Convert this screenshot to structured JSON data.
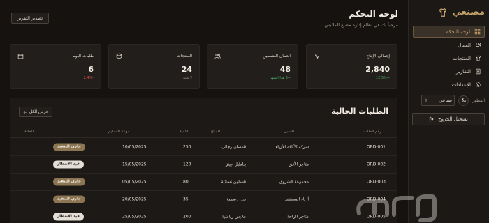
{
  "sidebar": {
    "brand": "مصنعي",
    "items": [
      {
        "label": "لوحة التحكم",
        "icon": "dashboard-icon",
        "active": true
      },
      {
        "label": "العمال",
        "icon": "users-icon"
      },
      {
        "label": "المنتجات",
        "icon": "shirt-icon"
      },
      {
        "label": "التقارير",
        "icon": "reports-icon"
      },
      {
        "label": "الإعدادات",
        "icon": "settings-icon"
      }
    ],
    "appearance_label": "المظهر",
    "theme_value": "صناعي",
    "logout": "تسجيل الخروج"
  },
  "header": {
    "title": "لوحة التحكم",
    "subtitle": "مرحباً بك في نظام إدارة مصنع الملابس",
    "export_label": "تصدير التقرير"
  },
  "stats": [
    {
      "label": "إجمالي الإنتاج",
      "value": "2,840",
      "note": "+12.5%",
      "note_tone": "green",
      "icon": "activity-icon"
    },
    {
      "label": "العمال النشطين",
      "value": "48",
      "note": "+3 هذا الشهر",
      "note_tone": "green",
      "icon": "users-icon"
    },
    {
      "label": "المنتجات",
      "value": "24",
      "note": "لا تغيير",
      "note_tone": "muted",
      "icon": "box-icon"
    },
    {
      "label": "طلبات اليوم",
      "value": "6",
      "note": "-2.4%",
      "note_tone": "red",
      "icon": "calendar-icon"
    }
  ],
  "orders": {
    "title": "الطلبات الحالية",
    "view_all": "عرض الكل",
    "columns": [
      "رقم الطلب",
      "العميل",
      "المنتج",
      "الكمية",
      "موعد التسليم",
      "الحالة"
    ],
    "rows": [
      {
        "id": "ORD-001",
        "customer": "شركة الأناقة للأزياء",
        "product": "قمصان رجالي",
        "qty": "250",
        "date": "10/05/2025",
        "status": "جاري التنفيذ",
        "status_tone": "progress"
      },
      {
        "id": "ORD-002",
        "customer": "متاجر الأفق",
        "product": "بناطيل جينز",
        "qty": "120",
        "date": "15/05/2025",
        "status": "قيد الانتظار",
        "status_tone": "waiting"
      },
      {
        "id": "ORD-003",
        "customer": "مجموعة الشروق",
        "product": "فساتين نسائية",
        "qty": "80",
        "date": "05/05/2025",
        "status": "جاري التنفيذ",
        "status_tone": "progress"
      },
      {
        "id": "ORD-004",
        "customer": "أزياء المستقبل",
        "product": "بدل رسمية",
        "qty": "35",
        "date": "20/05/2025",
        "status": "جاري التنفيذ",
        "status_tone": "progress"
      },
      {
        "id": "ORD-005",
        "customer": "متاجر الراحة",
        "product": "ملابس رياضية",
        "qty": "200",
        "date": "25/05/2025",
        "status": "قيد الانتظار",
        "status_tone": "waiting"
      }
    ]
  },
  "watermark": "حراج",
  "colors": {
    "background": "#151210",
    "card": "#221e1b",
    "accent": "#c9a46a",
    "positive": "#4caf6d",
    "negative": "#d9534f"
  }
}
